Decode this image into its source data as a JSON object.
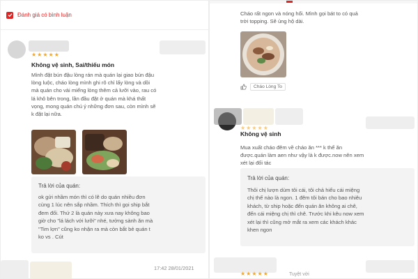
{
  "filter": {
    "label": "Đánh giá có bình luận"
  },
  "left_review": {
    "stars": "★★★★★",
    "tag": "Không vệ sinh, Sai/thiếu món",
    "text_lines": [
      "Mình đặt bún đậu lòng rán mà quán lại giao bún đậu",
      "lòng luộc, cháo lòng mình ghi rõ chỉ lấy lòng và dồi",
      "mà quán cho vài miếng lòng thêm cả lưỡi vào, rau có",
      "lá khô bên trong, lần đầu đặt ở quán mà khá thất",
      "vọng, mong quán chú ý những đơn sau, còn mình sẽ",
      "k đặt lại nữa."
    ],
    "reply_title": "Trả lời của quán:",
    "reply_lines": [
      "ok gửi nhầm món thì có lẽ do quán nhiều đơn",
      "cùng 1 lúc nên sắp nhầm. Thích thì gọi ship bắt",
      "đem đổi. Thứ 2 là quán này xưa nay không bao",
      "giờ cho \"lá lách với lưỡi\" nhé, tưởng sành ăn mà",
      "\"Tim lợn\" cũng ko nhận ra mà còn bắt bẻ quán t",
      "ko vs . Cút"
    ],
    "timestamp": "17:42 28/01/2021"
  },
  "right_top_review": {
    "text_lines": [
      "Cháo rất ngon và nóng hổi. Mình gọi bát to có quả",
      "trời topping. Sẽ ủng hộ dài."
    ],
    "like_label": "Cháo Lòng To"
  },
  "right_review": {
    "stars": "★★★★★",
    "tag": "Không vệ sinh",
    "text_lines": [
      "Mua xuất cháo đêm về cháo ăn *** k thể ăn",
      "được.quán làm aen như vậy là k được.now nên xem",
      "xét lại đối tác"
    ],
    "reply_title": "Trả lời của quán:",
    "reply_lines": [
      "Thôi chị lượn dùm tôi cái, tôi chả hiểu cái miệng",
      "chị thế nào là ngon. 1 đêm tôi bán cho bao nhiêu",
      "khách, từ ship hoặc đến quán ăn không ai chê,",
      "đến cái miệng chị thì chê. Trước khi kêu now xem",
      "xét lại thì cũng mở mắt ra xem các khách khác",
      "khen ngon"
    ]
  },
  "right_bottom": {
    "stars": "★★★★★",
    "sub": "Tuyệt vời"
  },
  "colors": {
    "accent": "#e02525",
    "star": "#f5a623",
    "reply_bg": "#f3f3f3"
  }
}
